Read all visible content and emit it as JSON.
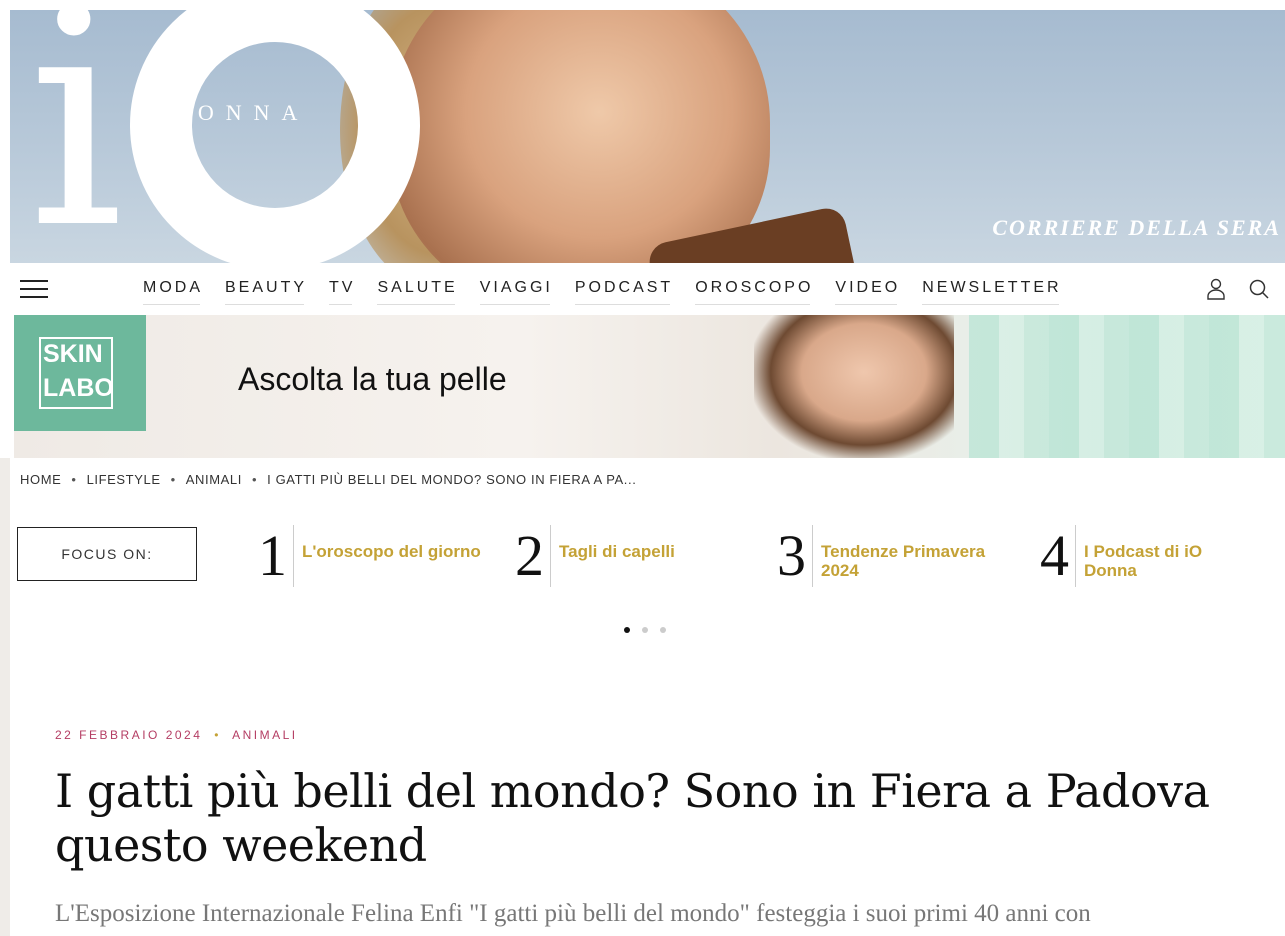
{
  "header": {
    "logo_donna": "DONNA",
    "corriere": "CORRIERE DELLA SERA"
  },
  "nav": {
    "items": [
      "MODA",
      "BEAUTY",
      "TV",
      "SALUTE",
      "VIAGGI",
      "PODCAST",
      "OROSCOPO",
      "VIDEO",
      "NEWSLETTER"
    ]
  },
  "ad": {
    "brand_line1": "SKIN",
    "brand_line2": "LABO",
    "tagline": "Ascolta la tua pelle"
  },
  "breadcrumb": {
    "items": [
      "HOME",
      "LIFESTYLE",
      "ANIMALI",
      "I GATTI PIÙ BELLI DEL MONDO? SONO IN FIERA A PA..."
    ]
  },
  "focus": {
    "label": "FOCUS ON:",
    "items": [
      {
        "num": "1",
        "text": "L'oroscopo del giorno"
      },
      {
        "num": "2",
        "text": "Tagli di capelli"
      },
      {
        "num": "3",
        "text": "Tendenze Primavera 2024"
      },
      {
        "num": "4",
        "text": "I Podcast di iO Donna"
      }
    ]
  },
  "article": {
    "date": "22 FEBBRAIO 2024",
    "bullet": "•",
    "category": "ANIMALI",
    "title": "I gatti più belli del mondo? Sono in Fiera a Padova questo weekend",
    "subtitle": "L'Esposizione Internazionale Felina Enfi \"I gatti più belli del mondo\" festeggia i suoi primi 40 anni con"
  },
  "colors": {
    "accent_gold": "#c4a236",
    "meta_pink": "#b43d63",
    "brand_green": "#6db89c"
  }
}
